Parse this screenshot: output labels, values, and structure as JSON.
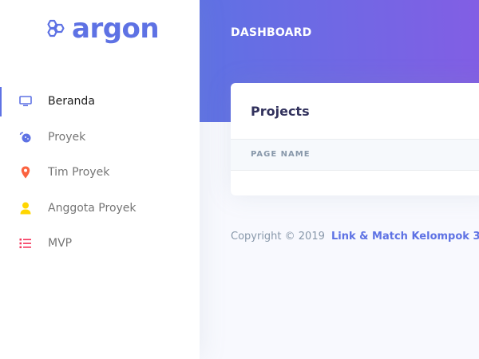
{
  "brand": {
    "name": "argon",
    "color": "#5e72e4"
  },
  "sidebar": {
    "items": [
      {
        "label": "Beranda",
        "icon": "tv-icon",
        "icon_color": "#5e72e4",
        "active": true
      },
      {
        "label": "Proyek",
        "icon": "planet-icon",
        "icon_color": "#5e72e4",
        "active": false
      },
      {
        "label": "Tim Proyek",
        "icon": "pin-icon",
        "icon_color": "#fb6340",
        "active": false
      },
      {
        "label": "Anggota Proyek",
        "icon": "user-icon",
        "icon_color": "#ffd600",
        "active": false
      },
      {
        "label": "MVP",
        "icon": "list-icon",
        "icon_color": "#f5365c",
        "active": false
      }
    ]
  },
  "header": {
    "title": "DASHBOARD"
  },
  "card": {
    "title": "Projects",
    "columns": [
      "PAGE NAME"
    ]
  },
  "footer": {
    "copyright": "Copyright © 2019",
    "link_label": "Link & Match Kelompok 3"
  }
}
